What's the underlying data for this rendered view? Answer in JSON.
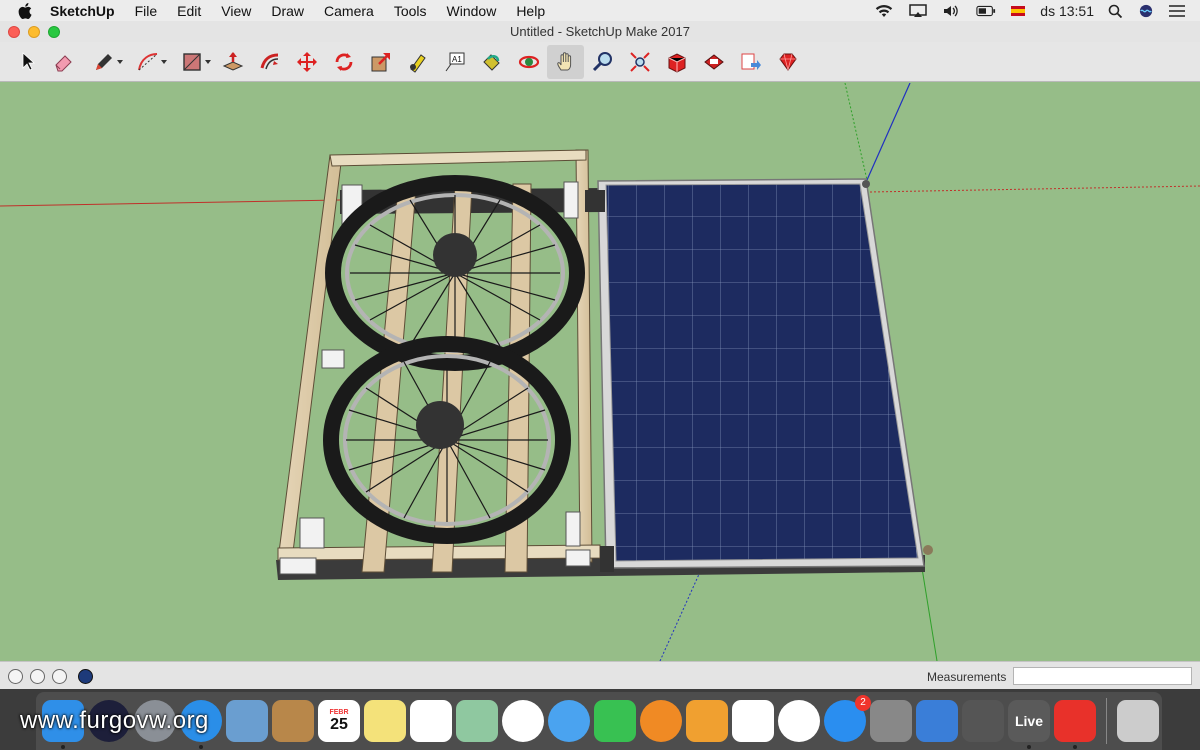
{
  "menubar": {
    "app_name": "SketchUp",
    "items": [
      "File",
      "Edit",
      "View",
      "Draw",
      "Camera",
      "Tools",
      "Window",
      "Help"
    ],
    "clock": "ds 13:51"
  },
  "window": {
    "title": "Untitled - SketchUp Make 2017"
  },
  "toolbar": {
    "tools": [
      {
        "name": "select",
        "icon": "arrow-cursor-icon"
      },
      {
        "name": "eraser",
        "icon": "eraser-icon"
      },
      {
        "name": "line",
        "icon": "pencil-icon"
      },
      {
        "name": "arc",
        "icon": "arc-icon"
      },
      {
        "name": "rectangle",
        "icon": "rectangle-icon"
      },
      {
        "name": "push-pull",
        "icon": "push-pull-icon"
      },
      {
        "name": "offset",
        "icon": "offset-icon"
      },
      {
        "name": "move",
        "icon": "move-icon"
      },
      {
        "name": "rotate",
        "icon": "rotate-icon"
      },
      {
        "name": "scale",
        "icon": "scale-icon"
      },
      {
        "name": "tape-measure",
        "icon": "tape-measure-icon"
      },
      {
        "name": "text",
        "icon": "text-icon"
      },
      {
        "name": "paint-bucket",
        "icon": "paint-bucket-icon"
      },
      {
        "name": "orbit",
        "icon": "orbit-icon"
      },
      {
        "name": "pan",
        "icon": "hand-icon"
      },
      {
        "name": "zoom",
        "icon": "magnifier-icon"
      },
      {
        "name": "zoom-extents",
        "icon": "zoom-extents-icon"
      },
      {
        "name": "3d-warehouse",
        "icon": "warehouse-icon"
      },
      {
        "name": "extension-warehouse",
        "icon": "extension-icon"
      },
      {
        "name": "layout",
        "icon": "send-to-layout-icon"
      },
      {
        "name": "extension-manager",
        "icon": "ruby-icon"
      }
    ],
    "active_tool": "pan",
    "text_tool_label": "A1"
  },
  "statusbar": {
    "measurements_label": "Measurements",
    "measurements_value": ""
  },
  "dock": {
    "apps": [
      {
        "name": "Finder",
        "icon": "finder-icon",
        "color": "#2f8fe8"
      },
      {
        "name": "Siri",
        "icon": "siri-icon",
        "color": "#1d1f3a"
      },
      {
        "name": "Launchpad",
        "icon": "rocket-icon",
        "color": "#8a8f96"
      },
      {
        "name": "Safari",
        "icon": "compass-icon",
        "color": "#2a8ee8"
      },
      {
        "name": "Mail",
        "icon": "mail-icon",
        "color": "#6a9ed0"
      },
      {
        "name": "Contacts",
        "icon": "contacts-icon",
        "color": "#b8874a"
      },
      {
        "name": "Calendar",
        "icon": "calendar-icon",
        "color": "#ffffff",
        "text": "25",
        "month": "FEBR"
      },
      {
        "name": "Notes",
        "icon": "notes-icon",
        "color": "#f4e27a"
      },
      {
        "name": "Reminders",
        "icon": "reminders-icon",
        "color": "#ffffff"
      },
      {
        "name": "Maps",
        "icon": "map-icon",
        "color": "#8fc8a0"
      },
      {
        "name": "Photos",
        "icon": "photos-icon",
        "color": "#ffffff"
      },
      {
        "name": "Messages",
        "icon": "messages-icon",
        "color": "#4aa3f0"
      },
      {
        "name": "FaceTime",
        "icon": "facetime-icon",
        "color": "#38c152"
      },
      {
        "name": "iBooks",
        "icon": "books-icon",
        "color": "#f08a24"
      },
      {
        "name": "Pages",
        "icon": "pages-icon",
        "color": "#f0a030"
      },
      {
        "name": "Numbers",
        "icon": "numbers-icon",
        "color": "#ffffff"
      },
      {
        "name": "iTunes",
        "icon": "music-icon",
        "color": "#ffffff"
      },
      {
        "name": "App Store",
        "icon": "app-store-icon",
        "color": "#2a8ef0",
        "badge": "2"
      },
      {
        "name": "System Preferences",
        "icon": "gear-icon",
        "color": "#888888"
      },
      {
        "name": "Keynote",
        "icon": "keynote-icon",
        "color": "#3a7ed8"
      },
      {
        "name": "Photo Booth",
        "icon": "photo-booth-icon",
        "color": "#555555"
      },
      {
        "name": "Live",
        "icon": "live-icon",
        "color": "#5a5a5a",
        "text": "Live"
      },
      {
        "name": "SketchUp",
        "icon": "sketchup-icon",
        "color": "#e8312a"
      },
      {
        "name": "Trash",
        "icon": "trash-icon",
        "color": "#cccccc"
      }
    ]
  },
  "watermark": "www.furgovw.org"
}
